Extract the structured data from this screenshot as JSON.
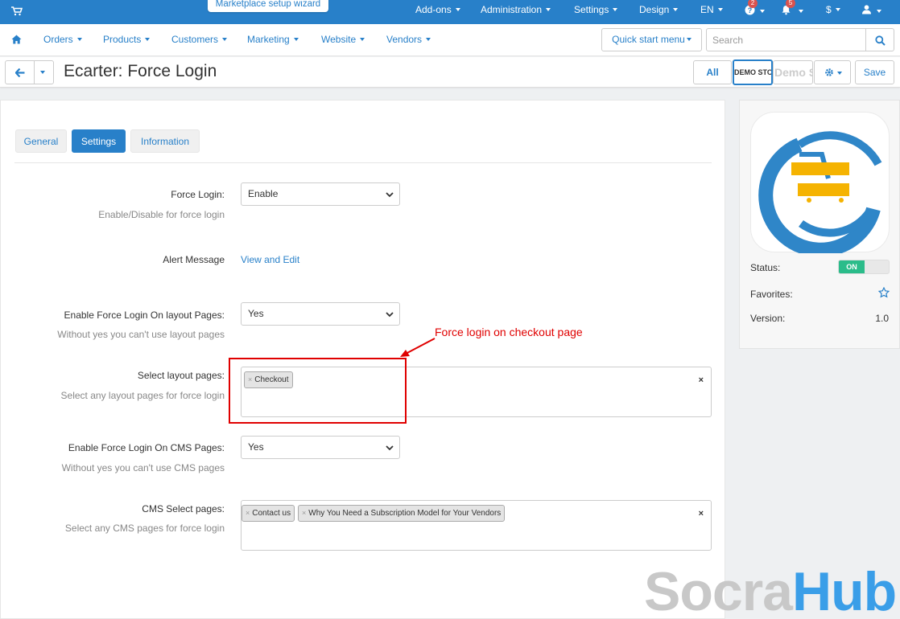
{
  "topbar": {
    "wizard_label": "Marketplace setup wizard",
    "menu": {
      "addons": "Add-ons",
      "administration": "Administration",
      "settings": "Settings",
      "design": "Design",
      "language": "EN",
      "currency": "$"
    },
    "help_badge": "2",
    "notifications_badge": "5"
  },
  "navbar": {
    "items": [
      "Orders",
      "Products",
      "Customers",
      "Marketing",
      "Website",
      "Vendors"
    ],
    "quick_start_label": "Quick start menu",
    "search_placeholder": "Search"
  },
  "titlebar": {
    "title": "Ecarter: Force Login",
    "all_label": "All",
    "storefront_1": "DEMO STORE",
    "storefront_2": "Demo Store",
    "save_label": "Save"
  },
  "tabs": [
    "General",
    "Settings",
    "Information"
  ],
  "form": {
    "force_login": {
      "label": "Force Login:",
      "value": "Enable",
      "hint": "Enable/Disable for force login"
    },
    "alert_message": {
      "label": "Alert Message",
      "link": "View and Edit"
    },
    "layout_pages_enabled": {
      "label": "Enable Force Login On layout Pages:",
      "value": "Yes",
      "hint": "Without yes you can't use layout pages"
    },
    "select_layout_pages": {
      "label": "Select layout pages:",
      "hint": "Select any layout pages for force login",
      "chips": [
        "Checkout"
      ]
    },
    "cms_pages_enabled": {
      "label": "Enable Force Login On CMS Pages:",
      "value": "Yes",
      "hint": "Without yes you can't use CMS pages"
    },
    "cms_select_pages": {
      "label": "CMS Select pages:",
      "hint": "Select any CMS pages for force login",
      "chips": [
        "Contact us",
        "Why You Need a Subscription Model for Your Vendors"
      ]
    }
  },
  "annotation": "Force login on checkout page",
  "side": {
    "status_label": "Status:",
    "status_value": "ON",
    "favorites_label": "Favorites:",
    "version_label": "Version:",
    "version_value": "1.0"
  },
  "watermark": {
    "part1": "Socra",
    "part2": "Hub"
  },
  "colors": {
    "primary": "#2880c9",
    "on_toggle": "#2bbc8a",
    "annotation": "#e00000",
    "icon_yellow": "#f5b301"
  }
}
